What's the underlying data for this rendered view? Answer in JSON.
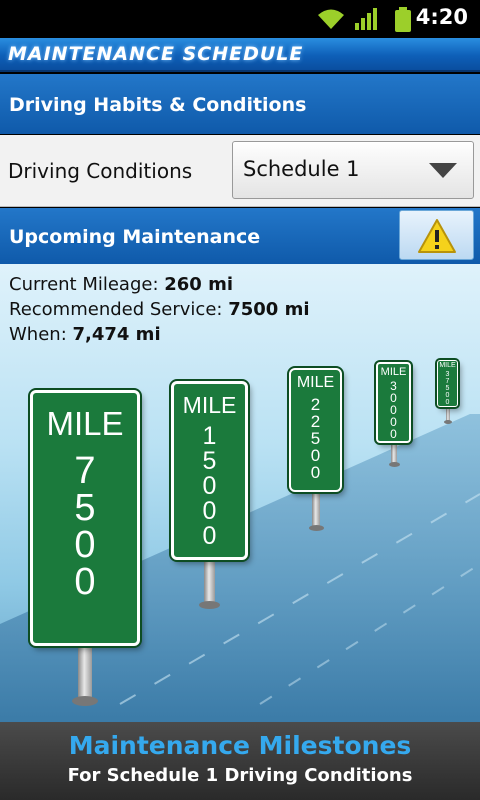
{
  "status_bar": {
    "time": "4:20",
    "icons": [
      "wifi-icon",
      "signal-icon",
      "battery-icon"
    ]
  },
  "app": {
    "title": "MAINTENANCE SCHEDULE"
  },
  "sections": {
    "habits_title": "Driving Habits & Conditions",
    "upcoming_title": "Upcoming Maintenance"
  },
  "driving_conditions": {
    "label": "Driving Conditions",
    "selected": "Schedule 1"
  },
  "warning_button": {
    "icon": "warning-icon"
  },
  "info": {
    "current_mileage_label": "Current Mileage: ",
    "current_mileage_value": "260 mi",
    "recommended_label": "Recommended Service: ",
    "recommended_value": "7500 mi",
    "when_label": "When: ",
    "when_value": "7,474 mi"
  },
  "milestones": [
    {
      "mile_label": "MILE",
      "number": "7500"
    },
    {
      "mile_label": "MILE",
      "number": "15000"
    },
    {
      "mile_label": "MILE",
      "number": "22500"
    },
    {
      "mile_label": "MILE",
      "number": "30000"
    },
    {
      "mile_label": "MILE",
      "number": "37500"
    }
  ],
  "footer": {
    "title": "Maintenance Milestones",
    "subtitle": "For Schedule 1 Driving Conditions"
  },
  "colors": {
    "title_bar": "#0e5fb8",
    "sign_green": "#1b7a3c",
    "footer_title": "#35a9ee",
    "warning_yellow": "#f5d21b"
  }
}
